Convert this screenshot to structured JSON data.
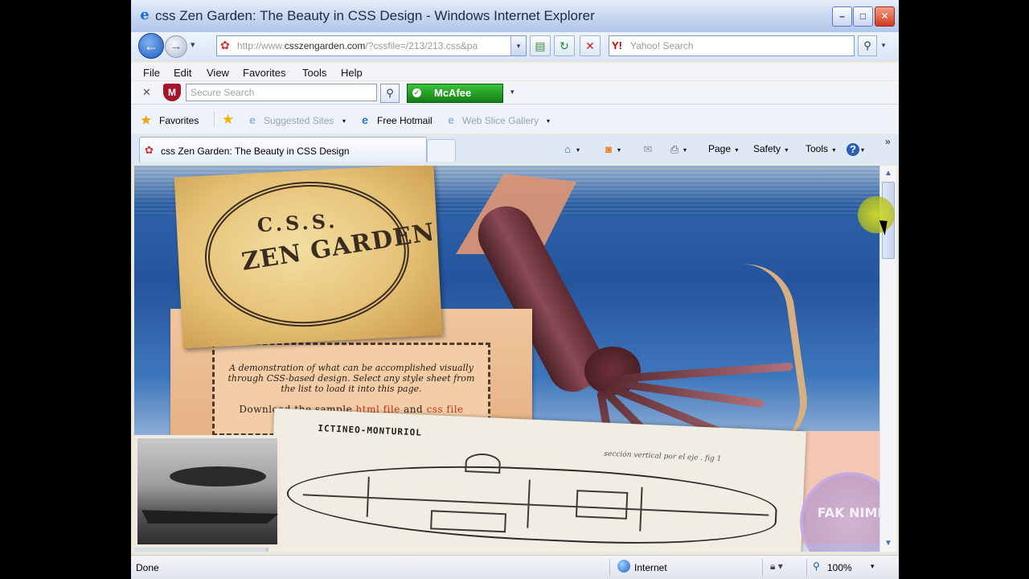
{
  "window": {
    "title": "css Zen Garden: The Beauty in CSS Design - Windows Internet Explorer",
    "minimize": "–",
    "maximize": "□",
    "close": "✕"
  },
  "toolbar": {
    "back_glyph": "←",
    "forward_glyph": "→",
    "history_glyph": "▾",
    "address_prefix": "http://www.",
    "address_domain": "csszengarden.com",
    "address_rest": "/?cssfile=/213/213.css&pa",
    "address_drop": "▾",
    "compat_glyph": "▤",
    "refresh_glyph": "↻",
    "stop_glyph": "✕",
    "search_placeholder": "Yahoo! Search",
    "search_brand": "Y!",
    "search_go": "⚲",
    "search_drop": "▾"
  },
  "menubar": {
    "items": [
      "File",
      "Edit",
      "View",
      "Favorites",
      "Tools",
      "Help"
    ]
  },
  "security_bar": {
    "close_glyph": "✕",
    "shield": "M",
    "placeholder": "Secure Search",
    "go_glyph": "⚲",
    "brand": "McAfee",
    "brand_glyph": "✓",
    "drop": "▾"
  },
  "favorites_bar": {
    "label": "Favorites",
    "links": [
      {
        "label": "Suggested Sites",
        "icon": "e"
      },
      {
        "label": "Free Hotmail",
        "icon": "e"
      },
      {
        "label": "Web Slice Gallery",
        "icon": "e"
      }
    ],
    "drop": "▾"
  },
  "tabs": {
    "active_label": "css Zen Garden: The Beauty in CSS Design"
  },
  "command_bar": {
    "home_glyph": "⌂",
    "feeds_glyph": "◙",
    "mail_glyph": "✉",
    "print_glyph": "⎙",
    "help_glyph": "?",
    "page": "Page",
    "safety": "Safety",
    "tools": "Tools",
    "drop": "▾",
    "chevron": "»"
  },
  "page": {
    "logo_line1": "C.S.S.",
    "logo_line2": "ZEN GARDEN",
    "intro": "A demonstration of what can be accomplished visually through CSS-based design. Select any style sheet from the list to load it into this page.",
    "download_prefix": "Download the sample",
    "html_link": "html file",
    "and": "and",
    "css_link": "css file",
    "blueprint_title": "ICTINEO-MONTURIOL",
    "blueprint_caption": "sección vertical por el eje . fig 1",
    "watermark": "FAK NIMI"
  },
  "scrollbar": {
    "up": "▲",
    "down": "▼"
  },
  "statusbar": {
    "status": "Done",
    "zone": "Internet",
    "lock": "🔒︎ ▾",
    "zoom_glyph": "⚲",
    "zoom": "100%",
    "zoom_drop": "▾"
  }
}
